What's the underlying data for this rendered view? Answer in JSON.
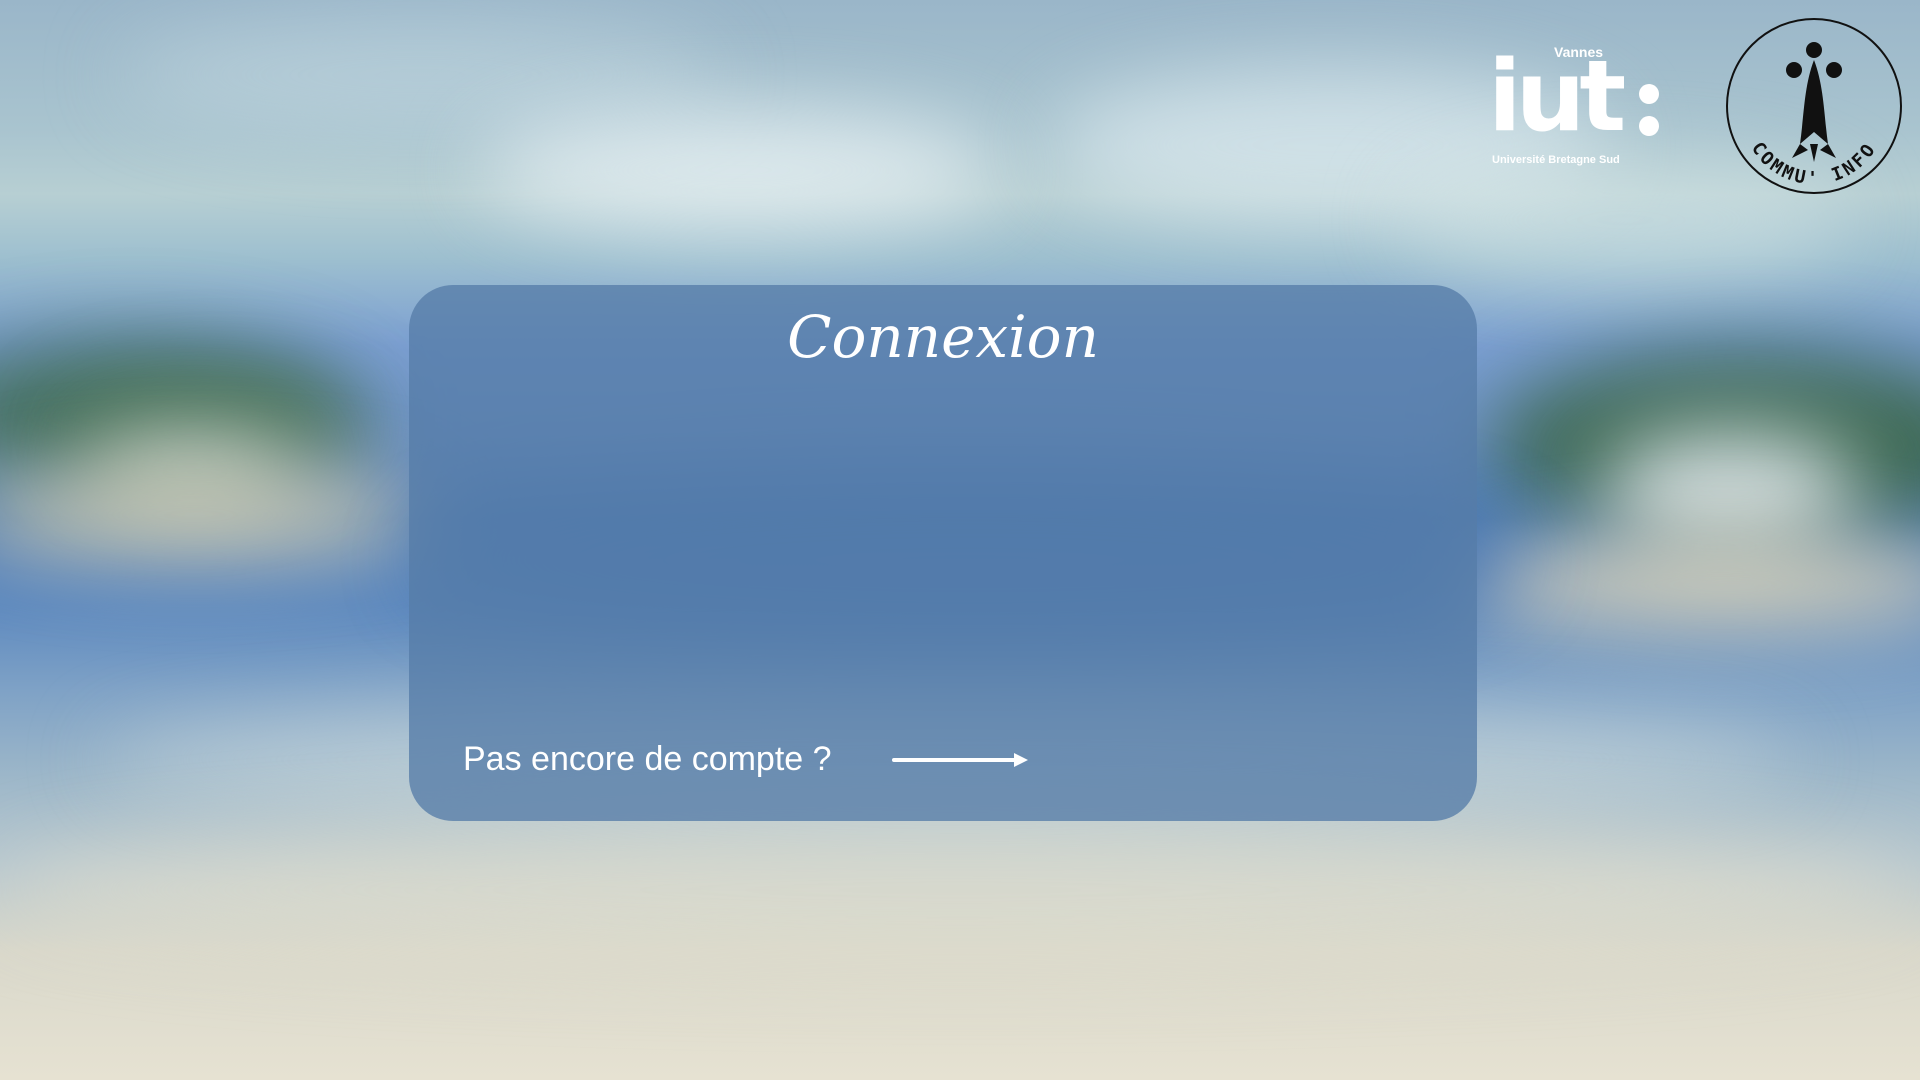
{
  "login_card": {
    "title": "Connexion",
    "signup_prompt": "Pas encore de compte ?",
    "signup_arrow_icon": "arrow-right-icon"
  },
  "logos": {
    "iut": {
      "city": "Vannes",
      "wordmark": "iut",
      "subtitle": "Université Bretagne Sud"
    },
    "club_seal": {
      "text": "COMMU' INFO",
      "icon": "ermine-icon"
    }
  },
  "colors": {
    "card_background": "#567CA8",
    "text": "#FFFFFF"
  }
}
